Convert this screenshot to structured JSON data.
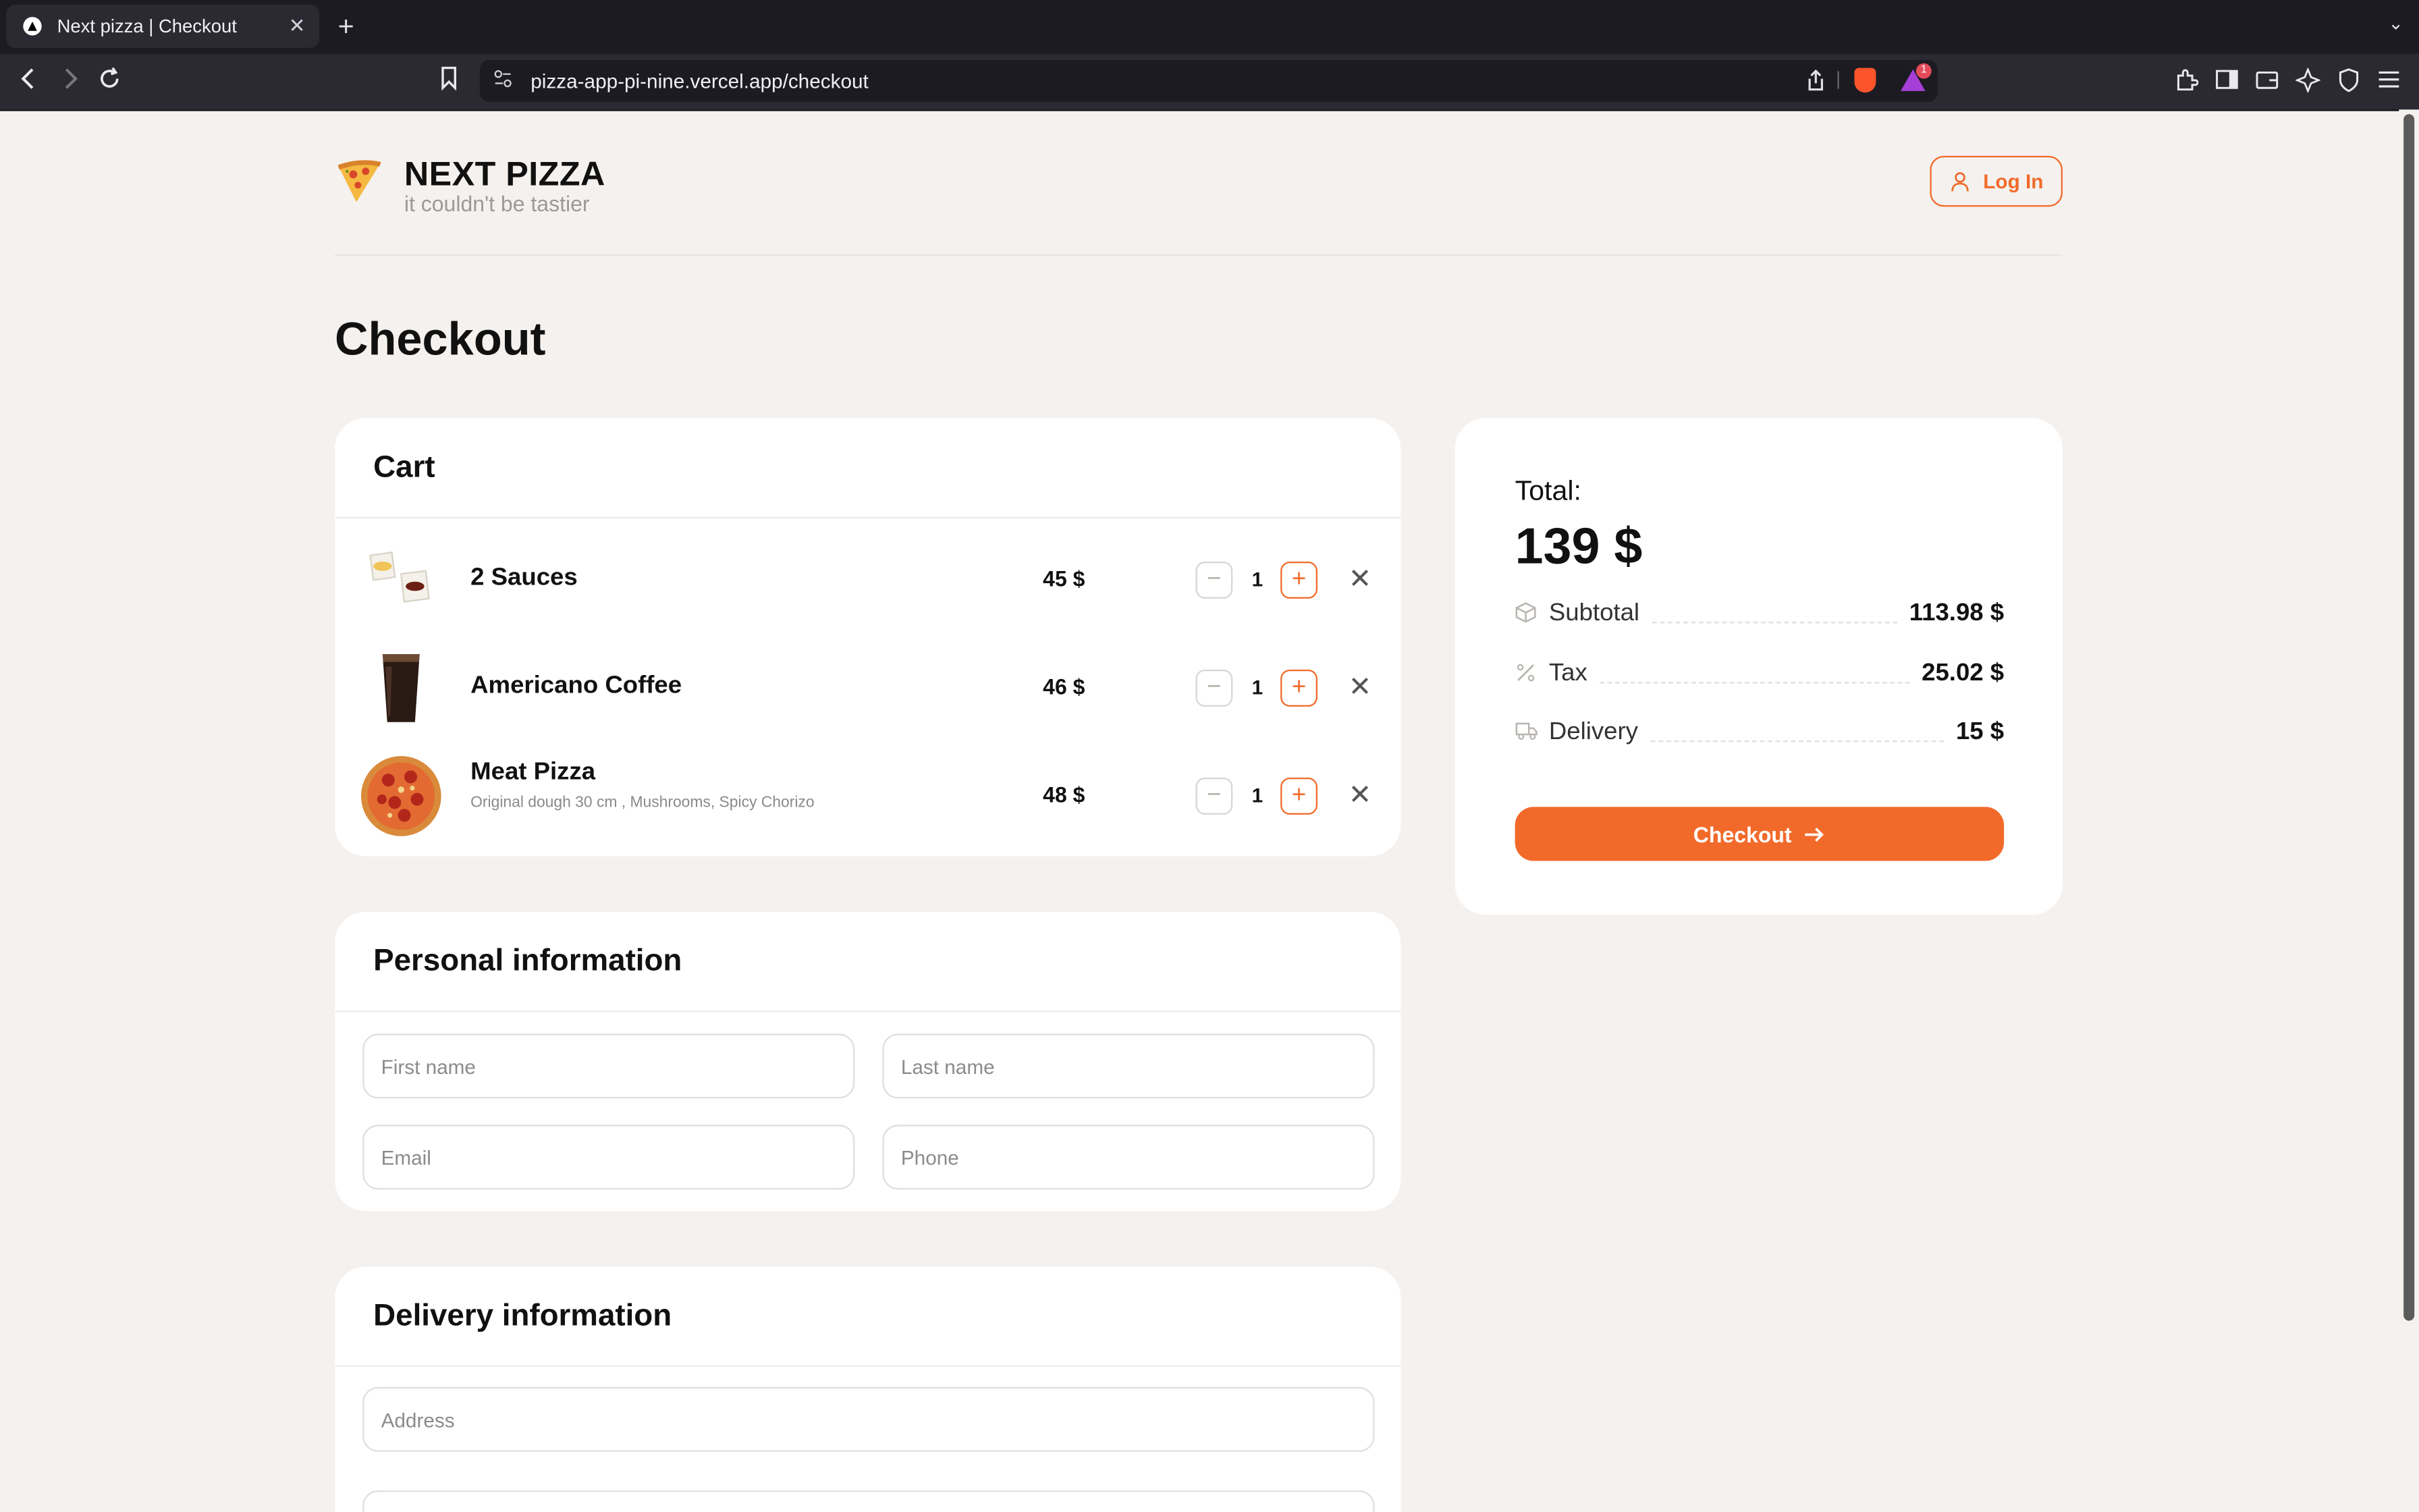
{
  "browser": {
    "tab_title": "Next pizza | Checkout",
    "tab_close": "✕",
    "new_tab": "+",
    "url": "pizza-app-pi-nine.vercel.app/checkout",
    "rewards_badge": "1"
  },
  "header": {
    "brand": "NEXT PIZZA",
    "tagline": "it couldn't be tastier",
    "login_label": "Log In"
  },
  "page": {
    "title": "Checkout"
  },
  "cart": {
    "title": "Cart",
    "items": [
      {
        "name": "2 Sauces",
        "description": "",
        "price": "45 $",
        "quantity": "1"
      },
      {
        "name": "Americano Coffee",
        "description": "",
        "price": "46 $",
        "quantity": "1"
      },
      {
        "name": "Meat Pizza",
        "description": "Original dough 30 cm , Mushrooms, Spicy Chorizo",
        "price": "48 $",
        "quantity": "1"
      }
    ]
  },
  "summary": {
    "total_label": "Total:",
    "total_value": "139 $",
    "subtotal_label": "Subtotal",
    "subtotal_value": "113.98 $",
    "tax_label": "Tax",
    "tax_value": "25.02 $",
    "delivery_label": "Delivery",
    "delivery_value": "15 $",
    "checkout_label": "Checkout"
  },
  "personal": {
    "title": "Personal information",
    "first_name_placeholder": "First name",
    "last_name_placeholder": "Last name",
    "email_placeholder": "Email",
    "phone_placeholder": "Phone"
  },
  "delivery": {
    "title": "Delivery information",
    "address_placeholder": "Address"
  },
  "colors": {
    "accent": "#f26a2a",
    "background": "#f4f1ee",
    "card": "#ffffff"
  }
}
